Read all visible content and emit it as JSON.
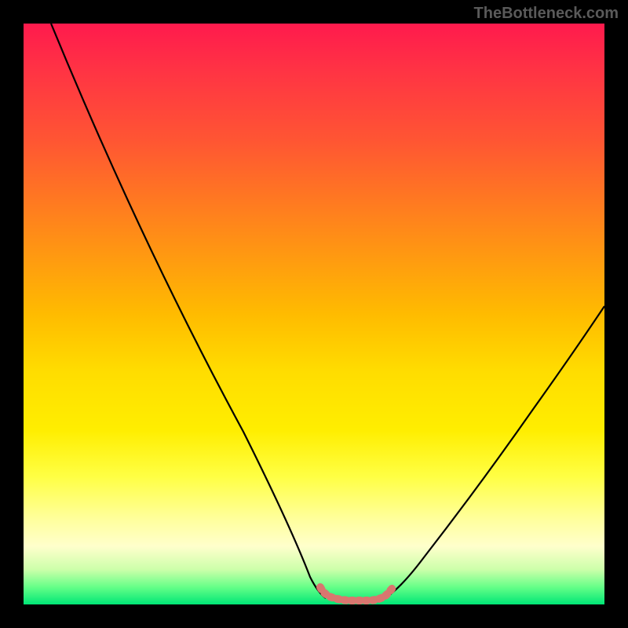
{
  "watermark": "TheBottleneck.com",
  "chart_data": {
    "type": "line",
    "title": "",
    "xlabel": "",
    "ylabel": "",
    "xlim": [
      0,
      100
    ],
    "ylim": [
      0,
      100
    ],
    "series": [
      {
        "name": "bottleneck-curve",
        "x": [
          5,
          15,
          25,
          35,
          45,
          48,
          50,
          52,
          55,
          58,
          60,
          65,
          75,
          85,
          95,
          100
        ],
        "y": [
          100,
          82,
          63,
          44,
          18,
          8,
          3,
          1,
          0,
          0,
          1,
          4,
          18,
          33,
          48,
          55
        ]
      }
    ],
    "annotations": [
      {
        "name": "optimal-zone",
        "type": "marker-band",
        "x_range": [
          48,
          60
        ],
        "color": "#d9766f"
      }
    ],
    "gradient_background": {
      "top_color": "#ff1a4d",
      "bottom_color": "#00e676",
      "meaning": "red=high bottleneck, green=optimal"
    }
  }
}
